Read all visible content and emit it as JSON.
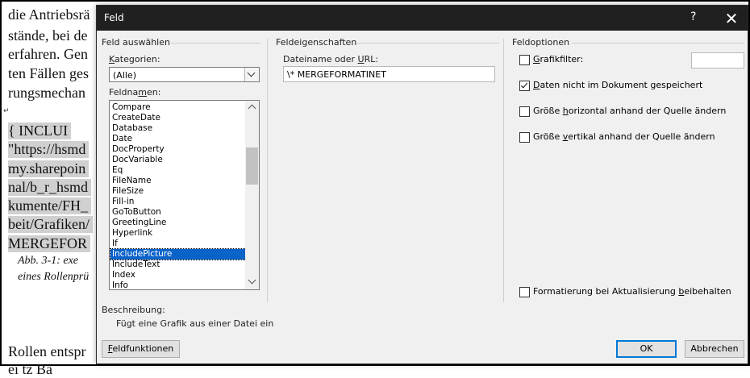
{
  "document": {
    "lines": [
      "die Antriebsrä",
      "stände, bei de",
      "erfahren. Gen",
      "ten Fällen ges",
      "rungsmechan"
    ],
    "field_lines": [
      "{      INCLUI",
      "\"https://hsmd",
      "my.sharepoin",
      "nal/b_r_hsmd",
      "kumente/FH_",
      "beit/Grafiken/",
      "MERGEFOR"
    ],
    "caption_lines": [
      "Abb. 3-1:     exe",
      "eines Rollenprü"
    ],
    "bottom_lines": [
      "Rollen entspr",
      "ei    tz  Bä"
    ],
    "para_mark": "↵"
  },
  "dialog": {
    "title": "Feld",
    "help": "?",
    "close": "✕",
    "left": {
      "section": "Feld auswählen",
      "categories_label_pre": "",
      "categories_label_ul": "K",
      "categories_label_post": "ategorien:",
      "categories_value": "(Alle)",
      "fieldnames_label_pre": "Feldna",
      "fieldnames_label_ul": "m",
      "fieldnames_label_post": "en:",
      "items": [
        "Compare",
        "CreateDate",
        "Database",
        "Date",
        "DocProperty",
        "DocVariable",
        "Eq",
        "FileName",
        "FileSize",
        "Fill-in",
        "GoToButton",
        "GreetingLine",
        "Hyperlink",
        "If",
        "IncludePicture",
        "IncludeText",
        "Index",
        "Info"
      ],
      "selected": "IncludePicture"
    },
    "middle": {
      "section": "Feldeigenschaften",
      "url_label_pre": "Dateiname oder ",
      "url_label_ul": "U",
      "url_label_post": "RL:",
      "url_value": "\\* MERGEFORMATINET"
    },
    "right": {
      "section": "Feldoptionen",
      "opt1_pre": "",
      "opt1_ul": "G",
      "opt1_post": "rafikfilter:",
      "opt1_checked": false,
      "opt2_pre": "",
      "opt2_ul": "D",
      "opt2_post": "aten nicht im Dokument gespeichert",
      "opt2_checked": true,
      "opt3_pre": "Größe ",
      "opt3_ul": "h",
      "opt3_post": "orizontal anhand der Quelle ändern",
      "opt3_checked": false,
      "opt4_pre": "Größe ",
      "opt4_ul": "v",
      "opt4_post": "ertikal anhand der Quelle ändern",
      "opt4_checked": false,
      "opt5_pre": "Formatierung bei Aktualisierung ",
      "opt5_ul": "b",
      "opt5_post": "eibehalten",
      "opt5_checked": false
    },
    "description": {
      "label": "Beschreibung:",
      "text": "Fügt eine Grafik aus einer Datei ein"
    },
    "buttons": {
      "codes_ul": "F",
      "codes_post": "eldfunktionen",
      "ok": "OK",
      "cancel": "Abbrechen"
    }
  }
}
